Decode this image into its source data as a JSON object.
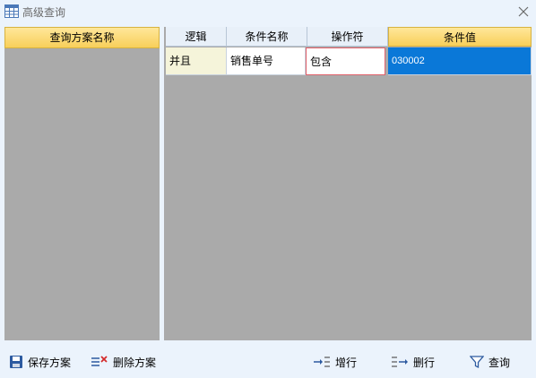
{
  "window": {
    "title": "高级查询"
  },
  "left_panel": {
    "header": "查询方案名称"
  },
  "grid": {
    "columns": [
      "逻辑",
      "条件名称",
      "操作符",
      "条件值"
    ],
    "rows": [
      {
        "logic": "并且",
        "name": "销售单号",
        "operator": "包含",
        "value": "030002"
      }
    ]
  },
  "toolbar": {
    "save_label": "保存方案",
    "delete_label": "删除方案",
    "add_row_label": "增行",
    "delete_row_label": "删行",
    "query_label": "查询"
  },
  "colors": {
    "background": "#ebf3fc",
    "panel_gray": "#aaaaaa",
    "header_yellow": "#f8cf5a",
    "selected_blue": "#0a78d8",
    "focus_red": "#e0606a"
  }
}
